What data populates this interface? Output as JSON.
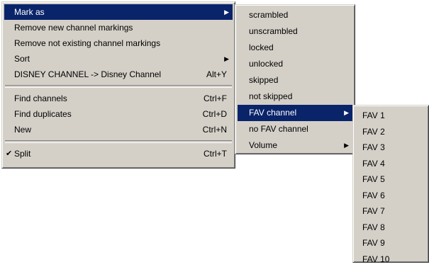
{
  "context_menu": {
    "items": [
      {
        "label": "Mark as",
        "shortcut": "",
        "has_submenu": true,
        "selected": true
      },
      {
        "label": "Remove new channel markings",
        "shortcut": ""
      },
      {
        "label": "Remove not existing channel markings",
        "shortcut": ""
      },
      {
        "label": "Sort",
        "shortcut": "",
        "has_submenu": true
      },
      {
        "label": "DISNEY CHANNEL -> Disney Channel",
        "shortcut": "Alt+Y"
      },
      {
        "label": "Find channels",
        "shortcut": "Ctrl+F"
      },
      {
        "label": "Find duplicates",
        "shortcut": "Ctrl+D"
      },
      {
        "label": "New",
        "shortcut": "Ctrl+N"
      },
      {
        "label": "Split",
        "shortcut": "Ctrl+T",
        "checked": true
      }
    ]
  },
  "mark_as_submenu": {
    "items": [
      {
        "label": "scrambled"
      },
      {
        "label": "unscrambled"
      },
      {
        "label": "locked"
      },
      {
        "label": "unlocked"
      },
      {
        "label": "skipped"
      },
      {
        "label": "not skipped"
      },
      {
        "label": "FAV channel",
        "has_submenu": true,
        "selected": true
      },
      {
        "label": "no FAV channel"
      },
      {
        "label": "Volume",
        "has_submenu": true
      }
    ]
  },
  "fav_submenu": {
    "items": [
      {
        "label": "FAV 1"
      },
      {
        "label": "FAV 2"
      },
      {
        "label": "FAV 3"
      },
      {
        "label": "FAV 4"
      },
      {
        "label": "FAV 5"
      },
      {
        "label": "FAV 6"
      },
      {
        "label": "FAV 7"
      },
      {
        "label": "FAV 8"
      },
      {
        "label": "FAV 9"
      },
      {
        "label": "FAV 10"
      }
    ]
  },
  "glyphs": {
    "submenu_arrow": "▶",
    "checkmark": "✔"
  },
  "colors": {
    "menu_bg": "#d4d0c8",
    "highlight": "#0a246a",
    "highlight_text": "#ffffff"
  }
}
